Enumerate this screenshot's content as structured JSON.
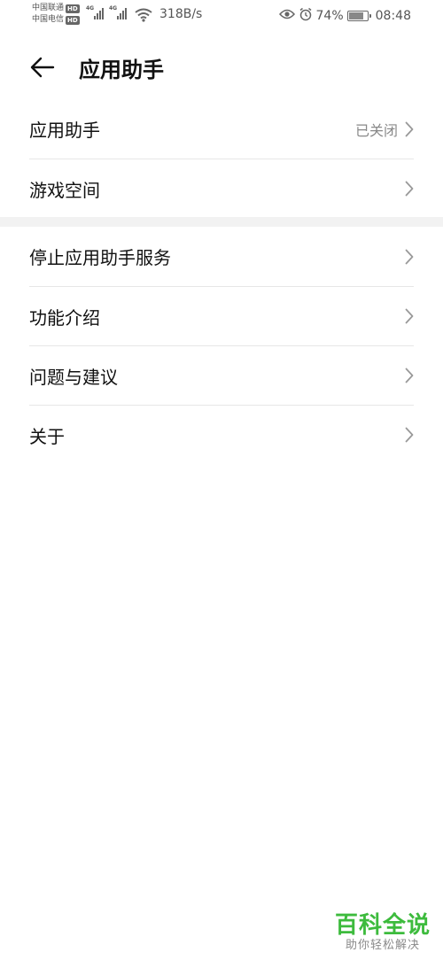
{
  "status_bar": {
    "carrier_1": "中国联通",
    "carrier_2": "中国电信",
    "hd_label": "HD",
    "network_type_1": "4G",
    "network_type_2": "4G",
    "net_speed": "318B/s",
    "battery_percent": "74%",
    "battery_level": 0.74,
    "time": "08:48",
    "icons": [
      "eye-icon",
      "alarm-icon",
      "wifi-icon",
      "signal-icon",
      "battery-icon"
    ]
  },
  "header": {
    "back_icon": "arrow-left-icon",
    "title": "应用助手"
  },
  "groups": [
    {
      "items": [
        {
          "label": "应用助手",
          "value": "已关闭"
        },
        {
          "label": "游戏空间",
          "value": ""
        }
      ]
    },
    {
      "items": [
        {
          "label": "停止应用助手服务",
          "value": ""
        },
        {
          "label": "功能介绍",
          "value": ""
        },
        {
          "label": "问题与建议",
          "value": ""
        },
        {
          "label": "关于",
          "value": ""
        }
      ]
    }
  ],
  "watermark": {
    "title": "百科全说",
    "subtitle": "助你轻松解决"
  },
  "colors": {
    "watermark_green": "#3dbb3d",
    "text_primary": "#111111",
    "text_secondary": "#888888",
    "divider": "#e6e6e6"
  }
}
